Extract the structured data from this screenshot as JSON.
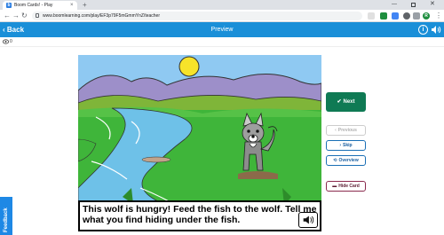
{
  "browser": {
    "tab_title": "Boom Cards! - Play",
    "tab_favicon": "b",
    "tab_close": "×",
    "new_tab": "+",
    "url": "www.boomlearning.com/play/EF3p79F5mGmmYnZ/teacher",
    "avatar_letter": "R",
    "menu_dots": "⋮",
    "back_glyph": "←",
    "forward_glyph": "→",
    "reload_glyph": "↻",
    "win_min": "—",
    "win_close": "✕"
  },
  "header": {
    "back_label": "‹ Back",
    "title": "Preview",
    "info_glyph": "i",
    "bg_color": "#1a8fd8"
  },
  "sub_toolbar": {
    "count": "0"
  },
  "card": {
    "caption": "This wolf is hungry! Feed the fish to the wolf.  Tell me what you find hiding under the fish."
  },
  "controls": {
    "next": "Next",
    "previous": "Previous",
    "skip": "Skip",
    "overview": "Overview",
    "hide_card": "Hide Card",
    "next_color": "#0f7a54",
    "next_icon": "✔",
    "previous_icon": "‹",
    "skip_icon": "›",
    "overview_icon": "⟲",
    "hide_icon": "▬"
  },
  "feedback": {
    "label": "Feedback"
  }
}
